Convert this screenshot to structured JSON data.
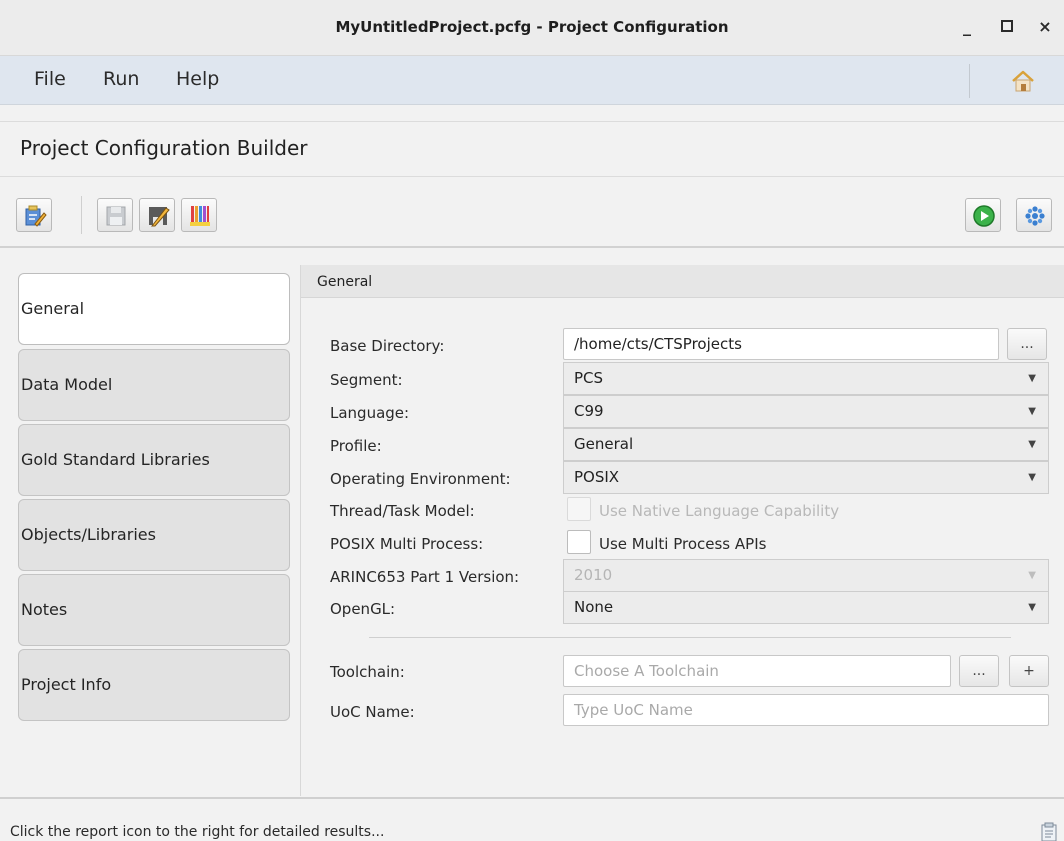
{
  "window": {
    "title": "MyUntitledProject.pcfg - Project Configuration",
    "minimize": "_",
    "maximize": "□",
    "close": "×"
  },
  "menu": {
    "items": [
      "File",
      "Run",
      "Help"
    ],
    "home_icon": "home-icon"
  },
  "header": {
    "title": "Project Configuration Builder"
  },
  "toolbar": {
    "left_icons": [
      "edit-project-icon",
      "save-icon",
      "save-as-icon",
      "chart-icon"
    ],
    "right_icons": [
      "run-icon",
      "settings-icon"
    ]
  },
  "nav": {
    "items": [
      "General",
      "Data Model",
      "Gold Standard Libraries",
      "Objects/Libraries",
      "Notes",
      "Project Info"
    ],
    "active": "General"
  },
  "general": {
    "section_title": "General",
    "base_directory": {
      "label": "Base Directory:",
      "value": "/home/cts/CTSProjects",
      "browse": "..."
    },
    "segment": {
      "label": "Segment:",
      "value": "PCS"
    },
    "language": {
      "label": "Language:",
      "value": "C99"
    },
    "profile": {
      "label": "Profile:",
      "value": "General"
    },
    "operating_environment": {
      "label": "Operating Environment:",
      "value": "POSIX"
    },
    "thread_model": {
      "label": "Thread/Task Model:",
      "checkbox_label": "Use Native Language Capability",
      "checked": false,
      "enabled": false
    },
    "posix_multi_process": {
      "label": "POSIX Multi Process:",
      "checkbox_label": "Use Multi Process APIs",
      "checked": false,
      "enabled": true
    },
    "arinc_version": {
      "label": "ARINC653 Part 1 Version:",
      "value": "2010",
      "enabled": false
    },
    "opengl": {
      "label": "OpenGL:",
      "value": "None"
    },
    "toolchain": {
      "label": "Toolchain:",
      "placeholder": "Choose A Toolchain",
      "browse": "...",
      "add": "+"
    },
    "uoc_name": {
      "label": "UoC Name:",
      "placeholder": "Type UoC Name"
    }
  },
  "status": {
    "text": "Click the report icon to the right for detailed results...",
    "icon": "report-icon"
  },
  "colors": {
    "run_green": "#3bb24a",
    "settings_blue": "#3a7fd0",
    "menubar_bg": "#dfe6ef"
  }
}
